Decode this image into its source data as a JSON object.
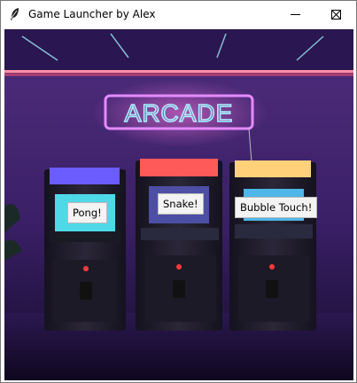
{
  "window": {
    "title": "Game Launcher by Alex"
  },
  "controls": {
    "minimize": "minimize-icon",
    "maximize": "maximize-icon",
    "close": "close-icon"
  },
  "scene": {
    "sign_text": "ARCADE"
  },
  "games": [
    {
      "label": "Pong!",
      "marquee_color": "#6a5cff"
    },
    {
      "label": "Snake!",
      "marquee_color": "#ff5a5a"
    },
    {
      "label": "Bubble Touch!",
      "marquee_color": "#ffd27a"
    }
  ],
  "colors": {
    "neon_accent": "#c77dff",
    "background_top": "#3b1d5e",
    "background_bottom": "#120a22"
  }
}
